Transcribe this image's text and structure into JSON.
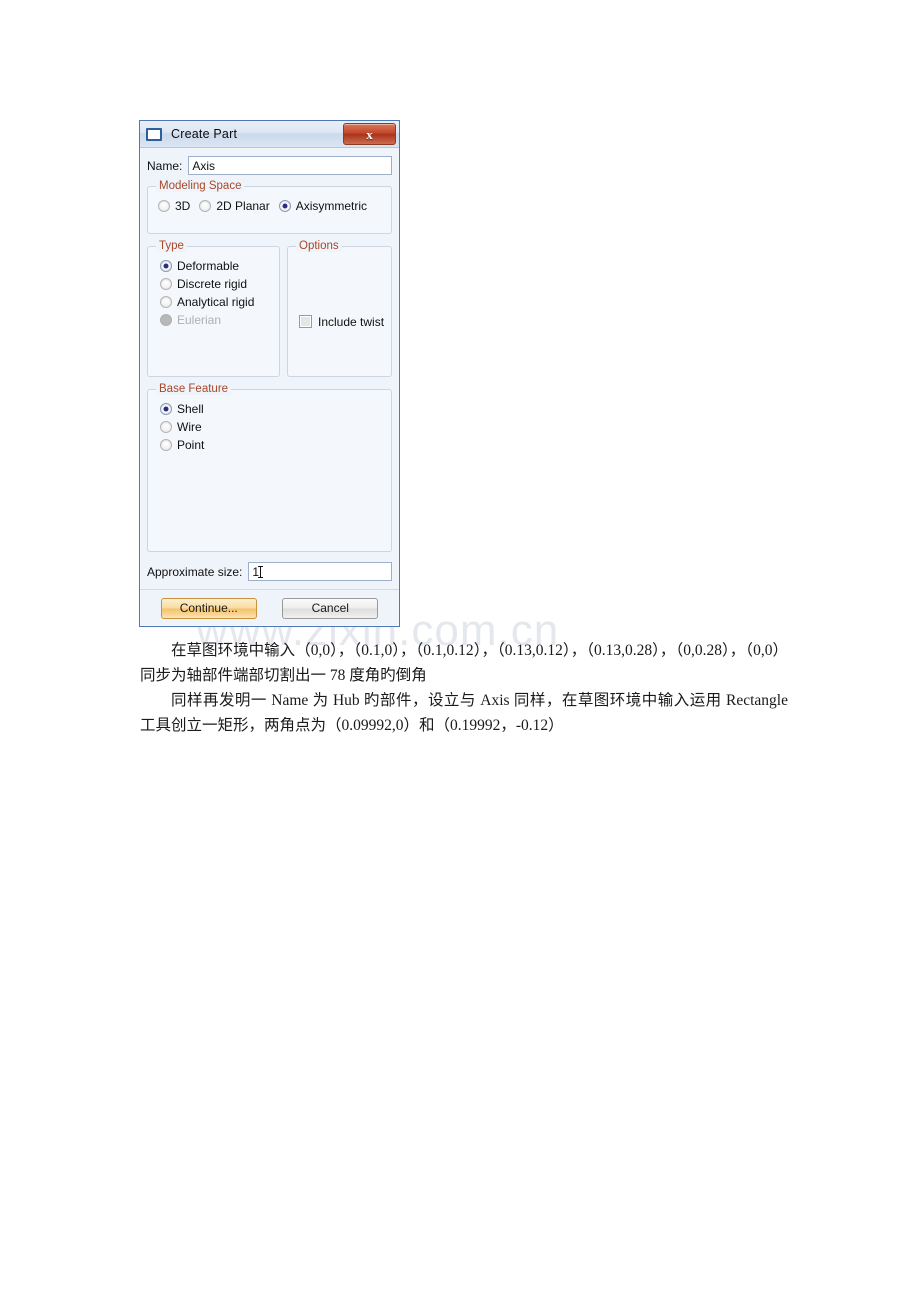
{
  "watermark": {
    "text": "www.zixin.com.cn"
  },
  "dialog": {
    "title": "Create Part",
    "icon": "window-icon",
    "close_label": "x",
    "name": {
      "label": "Name:",
      "value": "Axis",
      "placeholder": ""
    },
    "modeling_space": {
      "legend": "Modeling Space",
      "options": [
        {
          "label": "3D",
          "checked": false,
          "disabled": false
        },
        {
          "label": "2D Planar",
          "checked": false,
          "disabled": false
        },
        {
          "label": "Axisymmetric",
          "checked": true,
          "disabled": false
        }
      ]
    },
    "type": {
      "legend": "Type",
      "options": [
        {
          "label": "Deformable",
          "checked": true,
          "disabled": false
        },
        {
          "label": "Discrete rigid",
          "checked": false,
          "disabled": false
        },
        {
          "label": "Analytical rigid",
          "checked": false,
          "disabled": false
        },
        {
          "label": "Eulerian",
          "checked": false,
          "disabled": true
        }
      ]
    },
    "options": {
      "legend": "Options",
      "include_twist": {
        "label": "Include twist",
        "checked": false
      }
    },
    "base_feature": {
      "legend": "Base Feature",
      "options": [
        {
          "label": "Shell",
          "checked": true,
          "disabled": false
        },
        {
          "label": "Wire",
          "checked": false,
          "disabled": false
        },
        {
          "label": "Point",
          "checked": false,
          "disabled": false
        }
      ]
    },
    "approximate_size": {
      "label": "Approximate size:",
      "value": "1"
    },
    "buttons": {
      "continue": "Continue...",
      "cancel": "Cancel"
    },
    "colors": {
      "legend_text": "#a8482b",
      "frame_border": "#4f77b8",
      "radio_dot": "#2c2c85",
      "default_button": "#f5c268",
      "close_button": "#c4462a"
    }
  },
  "prose": {
    "paragraph1": "在草图环境中输入（0,0），（0.1,0），（0.1,0.12），（0.13,0.12），（0.13,0.28），（0,0.28），（0,0）同步为轴部件端部切割出一 78 度角旳倒角",
    "paragraph2": "同样再发明一 Name 为 Hub 旳部件，设立与 Axis 同样，在草图环境中输入运用 Rectangle 工具创立一矩形，两角点为（0.09992,0）和（0.19992，-0.12）"
  }
}
